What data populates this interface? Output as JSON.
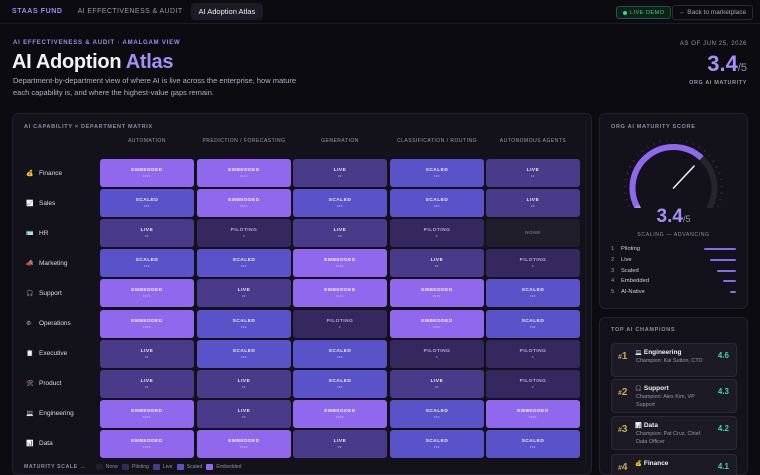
{
  "nav": {
    "brand": "STAAS FUND",
    "crumb": "AI EFFECTIVENESS & AUDIT",
    "active": "AI Adoption Atlas",
    "live_demo": "LIVE DEMO",
    "back": "← Back to marketplace"
  },
  "header": {
    "eyebrow": "AI EFFECTIVENESS & AUDIT · AMALGAM VIEW",
    "title_main": "AI Adoption",
    "title_accent": "Atlas",
    "subtitle": "Department-by-department view of where AI is live across the enterprise, how mature each capability is, and where the highest-value gaps remain.",
    "as_of": "AS OF JUN 25, 2026",
    "score": "3.4",
    "score_den": "/5",
    "score_label": "ORG AI MATURITY"
  },
  "matrix": {
    "title": "AI CAPABILITY × DEPARTMENT MATRIX",
    "columns": [
      "AUTOMATION",
      "PREDICTION / FORECASTING",
      "GENERATION",
      "CLASSIFICATION / ROUTING",
      "AUTONOMOUS AGENTS"
    ],
    "rows": [
      {
        "dept": "Finance",
        "icon": "money-bag-icon",
        "glyph": "💰",
        "cells": [
          "EMBEDDED",
          "EMBEDDED",
          "LIVE",
          "SCALED",
          "LIVE"
        ]
      },
      {
        "dept": "Sales",
        "icon": "chart-icon",
        "glyph": "📈",
        "cells": [
          "SCALED",
          "EMBEDDED",
          "SCALED",
          "SCALED",
          "LIVE"
        ]
      },
      {
        "dept": "HR",
        "icon": "badge-icon",
        "glyph": "🪪",
        "cells": [
          "LIVE",
          "PILOTING",
          "LIVE",
          "PILOTING",
          "NONE"
        ]
      },
      {
        "dept": "Marketing",
        "icon": "megaphone-icon",
        "glyph": "📣",
        "cells": [
          "SCALED",
          "SCALED",
          "EMBEDDED",
          "LIVE",
          "PILOTING"
        ]
      },
      {
        "dept": "Support",
        "icon": "headset-icon",
        "glyph": "🎧",
        "cells": [
          "EMBEDDED",
          "LIVE",
          "EMBEDDED",
          "EMBEDDED",
          "SCALED"
        ]
      },
      {
        "dept": "Operations",
        "icon": "gear-icon",
        "glyph": "⚙",
        "cells": [
          "EMBEDDED",
          "SCALED",
          "PILOTING",
          "EMBEDDED",
          "SCALED"
        ]
      },
      {
        "dept": "Executive",
        "icon": "clipboard-icon",
        "glyph": "📋",
        "cells": [
          "LIVE",
          "SCALED",
          "SCALED",
          "PILOTING",
          "PILOTING"
        ]
      },
      {
        "dept": "Product",
        "icon": "tools-icon",
        "glyph": "🛠",
        "cells": [
          "LIVE",
          "LIVE",
          "SCALED",
          "LIVE",
          "PILOTING"
        ]
      },
      {
        "dept": "Engineering",
        "icon": "laptop-icon",
        "glyph": "💻",
        "cells": [
          "EMBEDDED",
          "LIVE",
          "EMBEDDED",
          "SCALED",
          "EMBEDDED"
        ]
      },
      {
        "dept": "Data",
        "icon": "bar-chart-icon",
        "glyph": "📊",
        "cells": [
          "EMBEDDED",
          "EMBEDDED",
          "LIVE",
          "SCALED",
          "SCALED"
        ]
      }
    ],
    "legend_title": "MATURITY SCALE →",
    "legend": [
      "None",
      "Piloting",
      "Live",
      "Scaled",
      "Embedded"
    ]
  },
  "levels": {
    "NONE": {
      "class": "lvl-none",
      "dots": ""
    },
    "PILOTING": {
      "class": "lvl-piloting",
      "dots": "•"
    },
    "LIVE": {
      "class": "lvl-live",
      "dots": "••"
    },
    "SCALED": {
      "class": "lvl-scaled",
      "dots": "•••"
    },
    "EMBEDDED": {
      "class": "lvl-embedded",
      "dots": "••••"
    }
  },
  "maturity": {
    "title": "ORG AI MATURITY SCORE",
    "score": "3.4",
    "score_value": 3.4,
    "score_max": 5,
    "den": "/5",
    "sublabel": "SCALING — ADVANCING",
    "scale": [
      {
        "n": "1",
        "label": "Piloting",
        "frac": 0.99
      },
      {
        "n": "2",
        "label": "Live",
        "frac": 0.8
      },
      {
        "n": "3",
        "label": "Scaled",
        "frac": 0.6
      },
      {
        "n": "4",
        "label": "Embedded",
        "frac": 0.4
      },
      {
        "n": "5",
        "label": "AI-Native",
        "frac": 0.2
      }
    ]
  },
  "champions": {
    "title": "TOP AI CHAMPIONS",
    "items": [
      {
        "rank": "1",
        "glyph": "💻",
        "icon": "laptop-icon",
        "name": "Engineering",
        "who": "Champion: Kai Sutton, CTO",
        "score": "4.6"
      },
      {
        "rank": "2",
        "glyph": "🎧",
        "icon": "headset-icon",
        "name": "Support",
        "who": "Champion: Alex Kim, VP Support",
        "score": "4.3"
      },
      {
        "rank": "3",
        "glyph": "📊",
        "icon": "bar-chart-icon",
        "name": "Data",
        "who": "Champion: Pat Cruz, Chief Data Officer",
        "score": "4.2"
      },
      {
        "rank": "4",
        "glyph": "💰",
        "icon": "money-bag-icon",
        "name": "Finance",
        "who": "",
        "score": "4.1"
      }
    ]
  },
  "colors": {
    "accent": "#a98ff5",
    "none": "#201e2b",
    "piloting": "#35285e",
    "live": "#4a3a8a",
    "scaled": "#5a52c9",
    "embedded": "#8f68ee",
    "champion_score": "#45d2a8",
    "live_demo": "#3ed48a"
  }
}
